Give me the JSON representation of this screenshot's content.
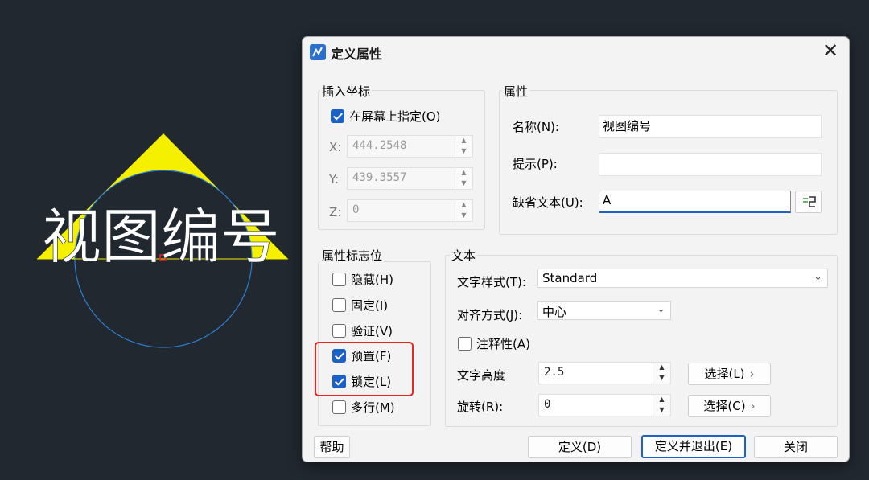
{
  "canvas": {
    "drawing_text": "视图编号"
  },
  "dialog": {
    "title": "定义属性",
    "close_glyph": "✕",
    "insert": {
      "group_title": "插入坐标",
      "on_screen_label": "在屏幕上指定(O)",
      "on_screen_checked": true,
      "x_label": "X:",
      "x_value": "444.2548",
      "y_label": "Y:",
      "y_value": "439.3557",
      "z_label": "Z:",
      "z_value": "0"
    },
    "attribute": {
      "group_title": "属性",
      "name_label": "名称(N):",
      "name_value": "视图编号",
      "prompt_label": "提示(P):",
      "prompt_value": "",
      "default_label": "缺省文本(U):",
      "default_value": "A"
    },
    "flags": {
      "group_title": "属性标志位",
      "items": [
        {
          "label": "隐藏(H)",
          "checked": false
        },
        {
          "label": "固定(I)",
          "checked": false
        },
        {
          "label": "验证(V)",
          "checked": false
        },
        {
          "label": "预置(F)",
          "checked": true
        },
        {
          "label": "锁定(L)",
          "checked": true
        },
        {
          "label": "多行(M)",
          "checked": false
        }
      ]
    },
    "text": {
      "group_title": "文本",
      "style_label": "文字样式(T):",
      "style_value": "Standard",
      "justify_label": "对齐方式(J):",
      "justify_value": "中心",
      "annotative_label": "注释性(A)",
      "annotative_checked": false,
      "height_label": "文字高度",
      "height_value": "2.5",
      "height_select_label": "选择(L)",
      "rotation_label": "旋转(R):",
      "rotation_value": "0",
      "rotation_select_label": "选择(C)"
    },
    "buttons": {
      "help": "帮助",
      "define": "定义(D)",
      "define_exit": "定义并退出(E)",
      "close": "关闭"
    }
  },
  "colors": {
    "accent": "#1a62c8",
    "highlight": "#e8261f",
    "canvas_bg": "#212830",
    "triangle": "#f5f000",
    "circle": "#2a7fd4"
  }
}
